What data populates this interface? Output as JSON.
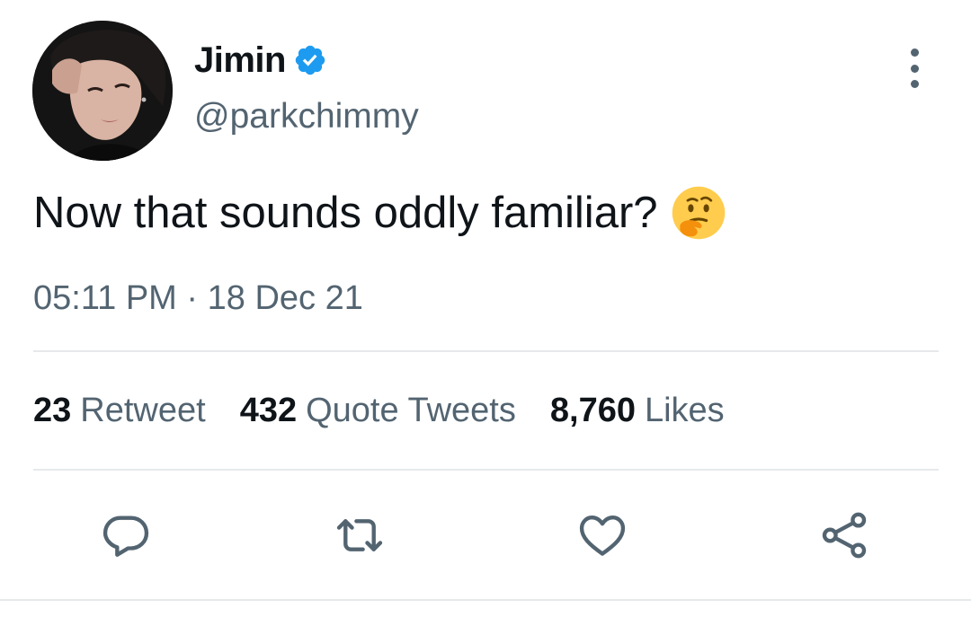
{
  "tweet": {
    "author": {
      "display_name": "Jimin",
      "handle": "@parkchimmy",
      "verified": true,
      "avatar": "profile-photo"
    },
    "text": "Now that sounds oddly familiar?",
    "emoji": "thinking-face",
    "time": "05:11 PM",
    "separator": "·",
    "date": "18 Dec 21",
    "stats": {
      "retweets_count": "23",
      "retweets_label": "Retweet",
      "quotes_count": "432",
      "quotes_label": "Quote Tweets",
      "likes_count": "8,760",
      "likes_label": "Likes"
    }
  },
  "icons": {
    "more": "more-vertical-icon",
    "reply": "reply-icon",
    "retweet": "retweet-icon",
    "like": "heart-icon",
    "share": "share-icon"
  },
  "colors": {
    "accent": "#1d9bf0",
    "text_primary": "#0f1419",
    "text_secondary": "#536471",
    "divider": "#e6e9eb",
    "emoji": "#ffcc4d"
  }
}
